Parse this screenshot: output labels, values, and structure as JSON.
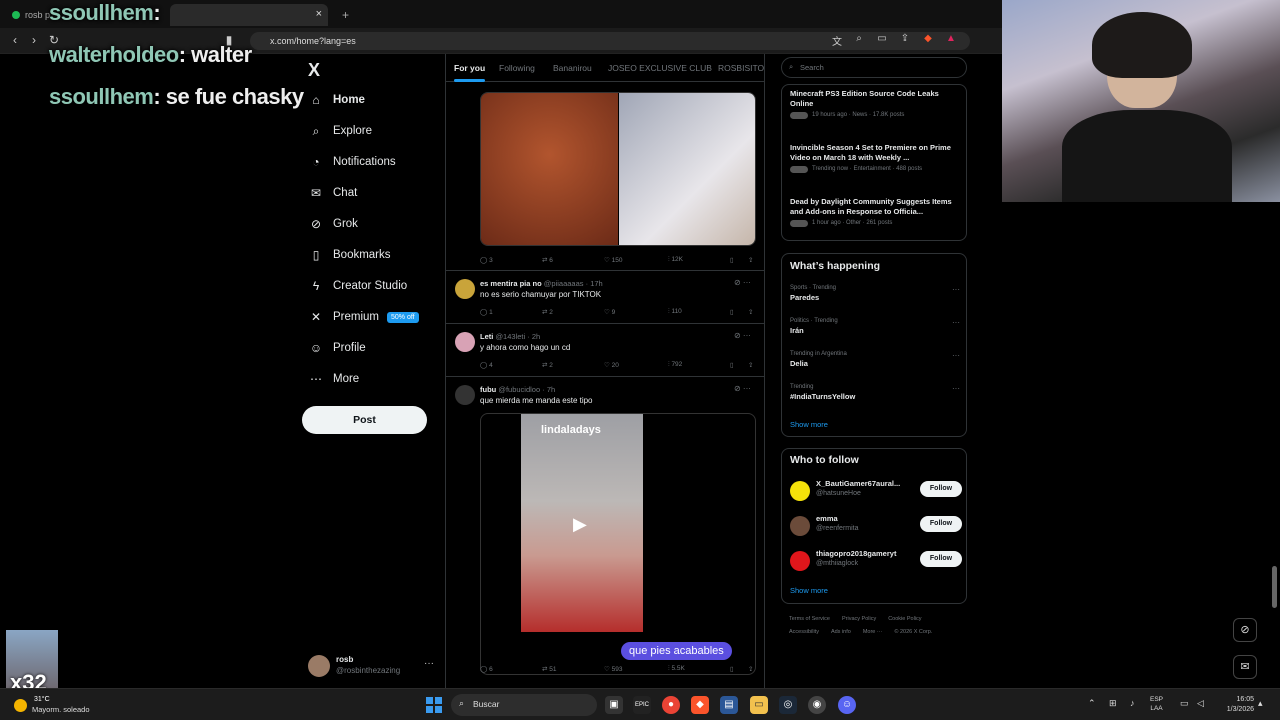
{
  "browser": {
    "tabs": [
      {
        "label": "rosb p"
      }
    ],
    "new_tab_label": "+",
    "url": "x.com/home?lang=es",
    "tab_close": "×"
  },
  "overlay": {
    "chat": [
      {
        "user": "ssoullhem",
        "msg": ""
      },
      {
        "user": "walterholdeo",
        "msg": ": walter"
      },
      {
        "user": "ssoullhem",
        "msg": ": se fue chasky"
      }
    ],
    "first_sep": ":",
    "x32": "x32"
  },
  "sidebar": {
    "logo": "X",
    "items": [
      {
        "label": "Home",
        "icon": "home-icon"
      },
      {
        "label": "Explore",
        "icon": "search-icon"
      },
      {
        "label": "Notifications",
        "icon": "bell-icon"
      },
      {
        "label": "Chat",
        "icon": "mail-icon"
      },
      {
        "label": "Grok",
        "icon": "grok-icon"
      },
      {
        "label": "Bookmarks",
        "icon": "bookmark-icon"
      },
      {
        "label": "Creator Studio",
        "icon": "lightning-icon"
      },
      {
        "label": "Premium",
        "icon": "x-icon",
        "badge": "50% off"
      },
      {
        "label": "Profile",
        "icon": "person-icon"
      },
      {
        "label": "More",
        "icon": "more-circle-icon"
      }
    ],
    "post_button": "Post",
    "account": {
      "name": "rosb",
      "handle": "@rosbinthezazing"
    }
  },
  "feed": {
    "tabs": [
      "For you",
      "Following",
      "Bananirou",
      "JOSEO EXCLUSIVE CLUB",
      "ROSBISITOS"
    ],
    "tweets": [
      {
        "name": "",
        "handle": "",
        "time": "",
        "text": "",
        "stats": {
          "replies": "3",
          "reposts": "6",
          "likes": "150",
          "views": "12K"
        }
      },
      {
        "name": "es mentira pia no",
        "handle": "@piiaaaaas",
        "time": "· 17h",
        "text": "no es serio chamuyar por TIKTOK",
        "stats": {
          "replies": "1",
          "reposts": "2",
          "likes": "9",
          "views": "110"
        }
      },
      {
        "name": "Leti",
        "handle": "@143leti",
        "time": "· 2h",
        "text": "y ahora como hago un cd",
        "stats": {
          "replies": "4",
          "reposts": "2",
          "likes": "20",
          "views": "792"
        }
      },
      {
        "name": "fubu",
        "handle": "@fubucidloo",
        "time": "· 7h",
        "text": "que mierda me manda este tipo",
        "stats": {
          "replies": "6",
          "reposts": "51",
          "likes": "593",
          "views": "5.5K"
        }
      }
    ],
    "video_channel": "lindaladays",
    "video_caption": "que pies acabables"
  },
  "right": {
    "search_placeholder": "Search",
    "news": [
      {
        "title": "Minecraft PS3 Edition Source Code Leaks Online",
        "meta": "19 hours ago · News · 17.8K posts"
      },
      {
        "title": "Invincible Season 4 Set to Premiere on Prime Video on March 18 with Weekly ...",
        "meta": "Trending now · Entertainment · 488 posts"
      },
      {
        "title": "Dead by Daylight Community Suggests Items and Add-ons in Response to Officia...",
        "meta": "1 hour ago · Other · 261 posts"
      }
    ],
    "happening_title": "What’s happening",
    "trends": [
      {
        "context": "Sports · Trending",
        "name": "Paredes"
      },
      {
        "context": "Politics · Trending",
        "name": "Irán"
      },
      {
        "context": "Trending in Argentina",
        "name": "Delia"
      },
      {
        "context": "Trending",
        "name": "#IndiaTurnsYellow"
      }
    ],
    "show_more": "Show more",
    "follow_title": "Who to follow",
    "follow": [
      {
        "name": "X_BautiGamer67aural...",
        "handle": "@hatsuneHoe",
        "button": "Follow",
        "color": "#f5e20a"
      },
      {
        "name": "emma",
        "handle": "@reenfermita",
        "button": "Follow",
        "color": "#6b4b3a"
      },
      {
        "name": "thiagopro2018gameryt",
        "handle": "@mthiiaglock",
        "button": "Follow",
        "color": "#e0161b"
      }
    ],
    "footer": [
      "Terms of Service",
      "Privacy Policy",
      "Cookie Policy",
      "Accessibility",
      "Ads info",
      "More ···",
      "© 2026 X Corp."
    ]
  },
  "taskbar": {
    "temp": "31°C",
    "weather": "Mayorm. soleado",
    "search": "Buscar",
    "lang1": "ESP",
    "lang2": "LAA",
    "time": "16:05",
    "date": "1/3/2026"
  }
}
